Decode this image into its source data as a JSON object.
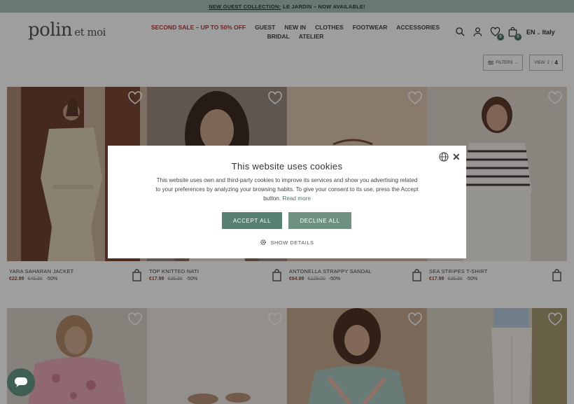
{
  "announcement": {
    "link": "NEW GUEST COLLECTION:",
    "rest": "LE JARDIN – NOW AVAILABLE!"
  },
  "brand": {
    "name": "polin",
    "suffix": "et moi"
  },
  "nav": [
    {
      "label": "SECOND SALE – UP TO 50% OFF",
      "sale": true
    },
    {
      "label": "GUEST"
    },
    {
      "label": "NEW IN"
    },
    {
      "label": "CLOTHES"
    },
    {
      "label": "FOOTWEAR"
    },
    {
      "label": "ACCESSORIES"
    },
    {
      "label": "BRIDAL"
    },
    {
      "label": "ATELIER"
    }
  ],
  "header": {
    "wishlist_count": "0",
    "cart_count": "0",
    "language": "EN",
    "country": "Italy"
  },
  "controls": {
    "filters": "FILTERS",
    "view_label": "VIEW",
    "view_option_a": "2",
    "view_option_b": "4"
  },
  "products": [
    {
      "name": "YARA SAHARAN JACKET",
      "price": "€22.99",
      "old_price": "€45.95",
      "discount": "-50%"
    },
    {
      "name": "TOP KNITTED NATI",
      "price": "€17.99",
      "old_price": "€35.95",
      "discount": "-50%"
    },
    {
      "name": "ANTONELLA STRAPPY SANDAL",
      "price": "€64.99",
      "old_price": "€129.00",
      "discount": "-50%"
    },
    {
      "name": "SEA STRIPES T-SHIRT",
      "price": "€17.99",
      "old_price": "€35.95",
      "discount": "-50%"
    }
  ],
  "cookie": {
    "title": "This website uses cookies",
    "body": "This website uses own and third-party cookies to improve its services and show you advertising related to your preferences by analyzing your browsing habits. To give your consent to its use, press the Accept button.",
    "read_more": "Read more",
    "accept": "ACCEPT ALL",
    "decline": "DECLINE ALL",
    "details": "SHOW DETAILS"
  },
  "colors": {
    "accent": "#56806f",
    "sale": "#b33b3b",
    "announcement_bg": "#a9c4b9"
  },
  "icons": [
    "search-icon",
    "user-icon",
    "heart-icon",
    "bag-icon",
    "globe-icon",
    "close-icon",
    "gear-icon",
    "chat-icon",
    "filter-icon",
    "chevron-down-icon"
  ]
}
